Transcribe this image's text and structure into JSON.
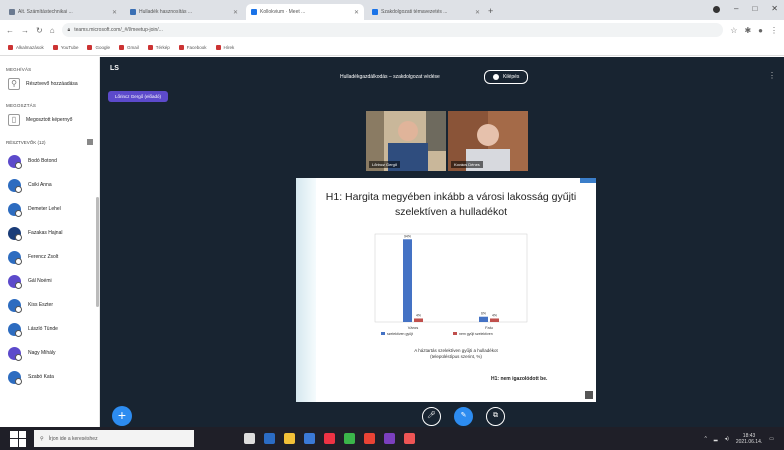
{
  "browser": {
    "tabs": [
      {
        "label": "Alt. Számítástechnikai ...",
        "active": false,
        "color": "#6b7a90"
      },
      {
        "label": "Hulladék hasznosítás ...",
        "active": false,
        "color": "#3a6fb4"
      },
      {
        "label": "Kollokvium · Meet ...",
        "active": true,
        "color": "#1a73e8"
      },
      {
        "label": "Szakdolgozati témavezetés ...",
        "active": false,
        "color": "#1a73e8"
      }
    ],
    "address": "teams.microsoft.com/_#/l/meetup-join/...",
    "bookmarks": [
      "Alkalmazások",
      "YouTube",
      "Google",
      "Gmail",
      "Térkép",
      "Facebook",
      "Hírek"
    ]
  },
  "sidebar": {
    "section1": "MEGHÍVÁS",
    "invite_label": "Résztvevő hozzáadása",
    "section2": "MEGOSZTÁS",
    "share_label": "Megosztott képernyő",
    "participants_header": "RÉSZTVEVŐK (12)",
    "participants": [
      {
        "name": "Bodó Botond",
        "color": "#5c4acb"
      },
      {
        "name": "Csiki Anna",
        "color": "#2d6cc0"
      },
      {
        "name": "Demeter Lehel",
        "color": "#2d6cc0"
      },
      {
        "name": "Fazakas Hajnal",
        "color": "#1a3c78"
      },
      {
        "name": "Ferencz Zsolt",
        "color": "#2d6cc0"
      },
      {
        "name": "Gál Noémi",
        "color": "#5c4acb"
      },
      {
        "name": "Kiss Eszter",
        "color": "#2d6cc0"
      },
      {
        "name": "László Tünde",
        "color": "#2d6cc0"
      },
      {
        "name": "Nagy Mihály",
        "color": "#5c4acb"
      },
      {
        "name": "Szabó Kata",
        "color": "#2d6cc0"
      }
    ]
  },
  "stage": {
    "user_initials": "LS",
    "presenter_chip": "Lőrincz Gergő (előadó)",
    "meeting_title": "Hulladékgazdálkodás – szakdolgozat védése",
    "leave_label": "Kilépés",
    "cameras": [
      {
        "name": "Lőrincz Gergő"
      },
      {
        "name": "Kovács Dénes"
      }
    ]
  },
  "slide": {
    "title": "H1: Hargita megyében inkább a városi lakosság gyűjti szelektíven a hulladékot",
    "caption_line1": "A háztartás szelektíven gyűjti a hulladékot",
    "caption_line2": "(településtípus szerint, %)",
    "footer": "H1: nem igazolódott be."
  },
  "chart_data": {
    "type": "bar",
    "categories": [
      "Város",
      "Falu"
    ],
    "series": [
      {
        "name": "szelektíven gyűjt",
        "values": [
          94,
          6
        ],
        "color": "#4472c4"
      },
      {
        "name": "nem gyűjt szelektíven",
        "values": [
          4,
          4
        ],
        "color": "#c0504d"
      }
    ],
    "ylim": [
      0,
      100
    ]
  },
  "taskbar": {
    "search_placeholder": "Írjon ide a kereséshez",
    "time": "18:43",
    "date": "2021.06.14."
  }
}
